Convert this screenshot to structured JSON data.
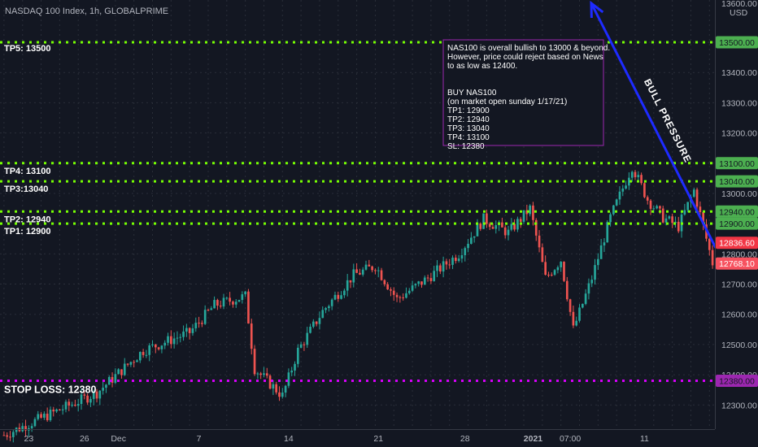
{
  "header": {
    "symbol_line": "NASDAQ 100 Index, 1h, GLOBALPRIME",
    "currency_top": "13600.00",
    "currency": "USD"
  },
  "chart_data": {
    "type": "candlestick",
    "ylim": [
      12220,
      13640
    ],
    "y_ticks": [
      12300,
      12400,
      12500,
      12600,
      12700,
      12800,
      12900,
      13000,
      13100,
      13200,
      13300,
      13400,
      13500
    ],
    "y_tick_labels": [
      "12300.00",
      "12400.00",
      "12500.00",
      "12600.00",
      "12700.00",
      "12800.00",
      "12900.00",
      "13000.00",
      "13100.00",
      "13200.00",
      "13300.00",
      "13400.00",
      "13500.00"
    ],
    "x_ticks": [
      {
        "label": "23",
        "bar": 8
      },
      {
        "label": "26",
        "bar": 26
      },
      {
        "label": "Dec",
        "bar": 37
      },
      {
        "label": "7",
        "bar": 63
      },
      {
        "label": "14",
        "bar": 92
      },
      {
        "label": "21",
        "bar": 121
      },
      {
        "label": "28",
        "bar": 149
      },
      {
        "label": "2021",
        "bar": 171
      },
      {
        "label": "07:00",
        "bar": 183
      },
      {
        "label": "11",
        "bar": 207
      }
    ],
    "bar_count": 230,
    "series": [
      {
        "bar": 0,
        "close": 12200
      },
      {
        "bar": 30,
        "close": 12340
      },
      {
        "bar": 45,
        "close": 12480
      },
      {
        "bar": 60,
        "close": 12540
      },
      {
        "bar": 68,
        "close": 12630
      },
      {
        "bar": 78,
        "close": 12660
      },
      {
        "bar": 81,
        "close": 12420
      },
      {
        "bar": 90,
        "close": 12330
      },
      {
        "bar": 95,
        "close": 12480
      },
      {
        "bar": 103,
        "close": 12610
      },
      {
        "bar": 113,
        "close": 12730
      },
      {
        "bar": 120,
        "close": 12760
      },
      {
        "bar": 127,
        "close": 12650
      },
      {
        "bar": 137,
        "close": 12720
      },
      {
        "bar": 147,
        "close": 12800
      },
      {
        "bar": 155,
        "close": 12915
      },
      {
        "bar": 163,
        "close": 12870
      },
      {
        "bar": 170,
        "close": 12950
      },
      {
        "bar": 175,
        "close": 12720
      },
      {
        "bar": 180,
        "close": 12780
      },
      {
        "bar": 184,
        "close": 12550
      },
      {
        "bar": 190,
        "close": 12720
      },
      {
        "bar": 196,
        "close": 12920
      },
      {
        "bar": 203,
        "close": 13090
      },
      {
        "bar": 208,
        "close": 12980
      },
      {
        "bar": 213,
        "close": 12920
      },
      {
        "bar": 218,
        "close": 12890
      },
      {
        "bar": 223,
        "close": 13010
      },
      {
        "bar": 229,
        "close": 12770
      }
    ],
    "levels": [
      {
        "label": "TP5: 13500",
        "value": 13500,
        "tag": "13500.00",
        "color": "#76ff03",
        "tag_bg": "#4caf50",
        "label_pos": "above"
      },
      {
        "label": "TP4: 13100",
        "value": 13100,
        "tag": "13100.00",
        "color": "#76ff03",
        "tag_bg": "#4caf50",
        "label_pos": "below"
      },
      {
        "label": "TP3:13040",
        "value": 13040,
        "tag": "13040.00",
        "color": "#76ff03",
        "tag_bg": "#4caf50",
        "label_pos": "below"
      },
      {
        "label": "TP2: 12940",
        "value": 12940,
        "tag": "12940.00",
        "color": "#76ff03",
        "tag_bg": "#4caf50",
        "label_pos": "below"
      },
      {
        "label": "TP1: 12900",
        "value": 12900,
        "tag": "12900.00",
        "color": "#76ff03",
        "tag_bg": "#4caf50",
        "label_pos": "below"
      },
      {
        "label": "STOP LOSS: 12380",
        "value": 12380,
        "tag": "12380.00",
        "color": "#d500f9",
        "tag_bg": "#9c27b0",
        "label_pos": "below"
      }
    ],
    "price_tags": [
      {
        "value": 12836.6,
        "tag": "12836.60",
        "bg": "#f23645",
        "fg": "#ffffff"
      },
      {
        "value": 12768.1,
        "tag": "12768.10",
        "bg": "#f7525f",
        "fg": "#ffffff"
      }
    ],
    "annotation": {
      "lines": [
        "NAS100 is overall bullish to 13000 & beyond.",
        "However, price could reject based on News",
        "to as low as 12400.",
        "",
        "",
        "BUY NAS100",
        "(on market open sunday 1/17/21)",
        "TP1: 12900",
        "TP2: 12940",
        "TP3: 13040",
        "TP4: 13100",
        "SL: 12380"
      ]
    },
    "arrow": {
      "label": "BULL PRESSURE",
      "color": "#1e2bff"
    },
    "colors": {
      "up": "#26a69a",
      "down": "#ef5350",
      "grid": "#2a2e39",
      "axis_text": "#b2b5be"
    }
  }
}
